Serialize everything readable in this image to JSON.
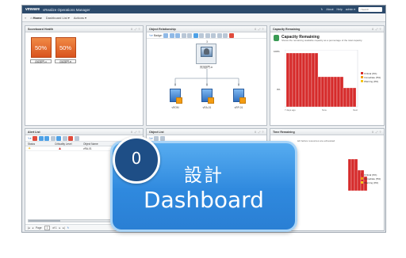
{
  "topbar": {
    "brand": "vmware",
    "product": "vRealize Operations Manager",
    "links": [
      "About",
      "Help",
      "admin ▾"
    ],
    "search_placeholder": "Search"
  },
  "nav": {
    "home": "Home",
    "items": [
      "Dashboard List ▾",
      "Actions ▾"
    ]
  },
  "panels": {
    "scoreboard": {
      "title": "Scoreboard Health",
      "tiles": [
        {
          "value": "50%",
          "label": "資訊部門-A",
          "color": "#e8652a"
        },
        {
          "value": "50%",
          "label": "資訊部門-B",
          "color": "#e8652a"
        }
      ]
    },
    "relationship": {
      "title": "Object Relationship",
      "badge_label": "Badge:",
      "root_label": "資訊部門-A",
      "root_count": "3",
      "children": [
        {
          "label": "vROM",
          "count": "0"
        },
        {
          "label": "vRA-01",
          "count": "0"
        },
        {
          "label": "vRP-01",
          "count": "0"
        }
      ]
    },
    "capacity": {
      "title": "Capacity Remaining",
      "heading": "Capacity Remaining",
      "description": "Shows the remaining available capacity as a percentage of the total capacity.",
      "yaxis_top": "100%",
      "yaxis_bottom": "0%",
      "x_labels": [
        "7 days ago",
        "Now",
        "Next"
      ],
      "legend": [
        "Critical (0%)",
        "Immediate (5%)",
        "Warning (0%)"
      ],
      "legend_colors": [
        "#d62b2b",
        "#f39c12",
        "#f5c518"
      ]
    },
    "alerts": {
      "title": "Alert List",
      "columns": [
        "Status",
        "Criticality Level",
        "Object Name"
      ],
      "rows": [
        {
          "status": "warning",
          "criticality": "critical",
          "object": "vRA-01"
        }
      ],
      "pager": {
        "page_label": "Page",
        "page": "1",
        "of": "of 1"
      }
    },
    "objects": {
      "title": "Object List"
    },
    "time_remaining": {
      "title": "Time Remaining",
      "description": "left before resources are exhausted",
      "legend": [
        "Critical (0%)",
        "Immediate (5%)",
        "Warning (0%)"
      ],
      "legend_colors": [
        "#d62b2b",
        "#f39c12",
        "#f5c518"
      ]
    }
  },
  "overlay": {
    "number": "0",
    "line1": "設計",
    "line2": "Dashboard"
  },
  "colors": {
    "chart_red": "#d62b2b",
    "overlay_blue": "#2f89de",
    "badge_navy": "#1e4e86"
  }
}
